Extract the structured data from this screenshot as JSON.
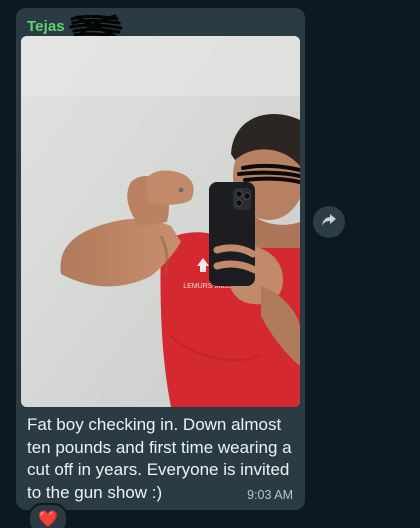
{
  "message": {
    "sender_name": "Tejas",
    "caption": "Fat boy checking in.  Down almost ten pounds and first time wearing a cut off in years.  Everyone is invited to the gun show :)",
    "time": "9:03 AM",
    "photo_shirt_text": "LEMURS MILE",
    "reaction_emoji": "❤️"
  },
  "icons": {
    "forward": "forward-arrow-icon",
    "reaction": "heart-icon"
  },
  "colors": {
    "background": "#0d1920",
    "bubble": "#2a3b44",
    "sender_name": "#5fd36b",
    "text": "#eef2f3",
    "timestamp": "#b9c4c9",
    "shirt": "#d42a2f"
  }
}
